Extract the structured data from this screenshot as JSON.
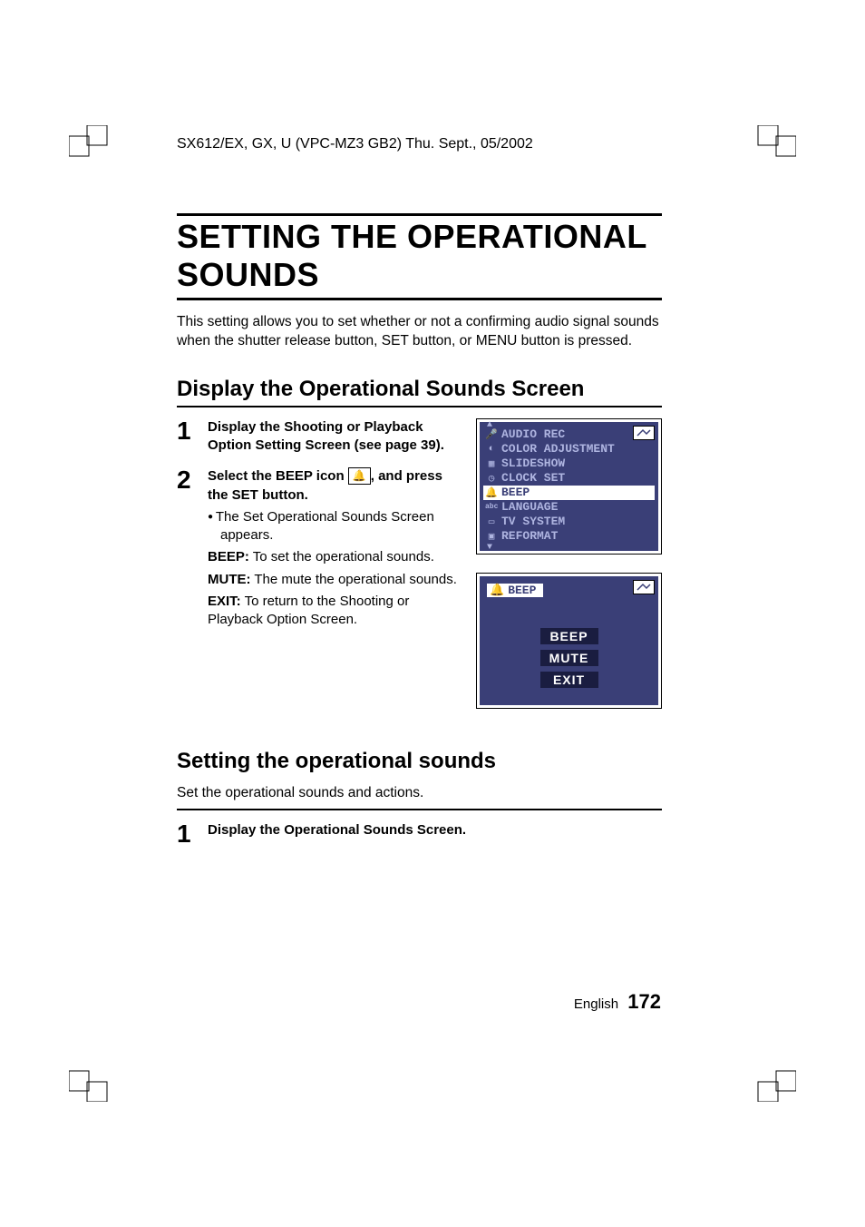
{
  "header": "SX612/EX, GX, U (VPC-MZ3 GB2)    Thu. Sept., 05/2002",
  "title": "SETTING THE OPERATIONAL SOUNDS",
  "intro": "This setting allows you to set whether or not a confirming audio signal sounds when the shutter release button, SET button, or MENU button is pressed.",
  "section1": {
    "heading": "Display the Operational Sounds Screen",
    "step1": {
      "num": "1",
      "text": "Display the Shooting or Playback Option Setting Screen (see page 39)."
    },
    "step2": {
      "num": "2",
      "title_a": "Select the BEEP icon ",
      "title_b": ", and press the SET button.",
      "bullet": "The Set Operational Sounds Screen appears.",
      "defs": [
        {
          "label": "BEEP:",
          "text": " To set the operational sounds."
        },
        {
          "label": "MUTE:",
          "text": " The mute the operational sounds."
        },
        {
          "label": "EXIT:",
          "text": " To return to the Shooting or Playback Option Screen."
        }
      ]
    }
  },
  "lcd1": {
    "rows": [
      {
        "icon": "🎤",
        "label": "AUDIO REC"
      },
      {
        "icon": "◐",
        "label": "COLOR ADJUSTMENT"
      },
      {
        "icon": "▦",
        "label": "SLIDESHOW"
      },
      {
        "icon": "◷",
        "label": "CLOCK SET"
      },
      {
        "icon": "🔔",
        "label": "BEEP",
        "selected": true
      },
      {
        "icon": "abc",
        "label": "LANGUAGE"
      },
      {
        "icon": "▭",
        "label": "TV SYSTEM"
      },
      {
        "icon": "▣",
        "label": "REFORMAT"
      }
    ]
  },
  "lcd2": {
    "title_icon": "🔔",
    "title": "BEEP",
    "buttons": [
      "BEEP",
      "MUTE",
      "EXIT"
    ]
  },
  "section2": {
    "heading": "Setting the operational sounds",
    "sub": "Set the operational sounds and actions.",
    "step1": {
      "num": "1",
      "text": "Display the Operational Sounds Screen."
    }
  },
  "footer": {
    "lang": "English",
    "page": "172"
  }
}
